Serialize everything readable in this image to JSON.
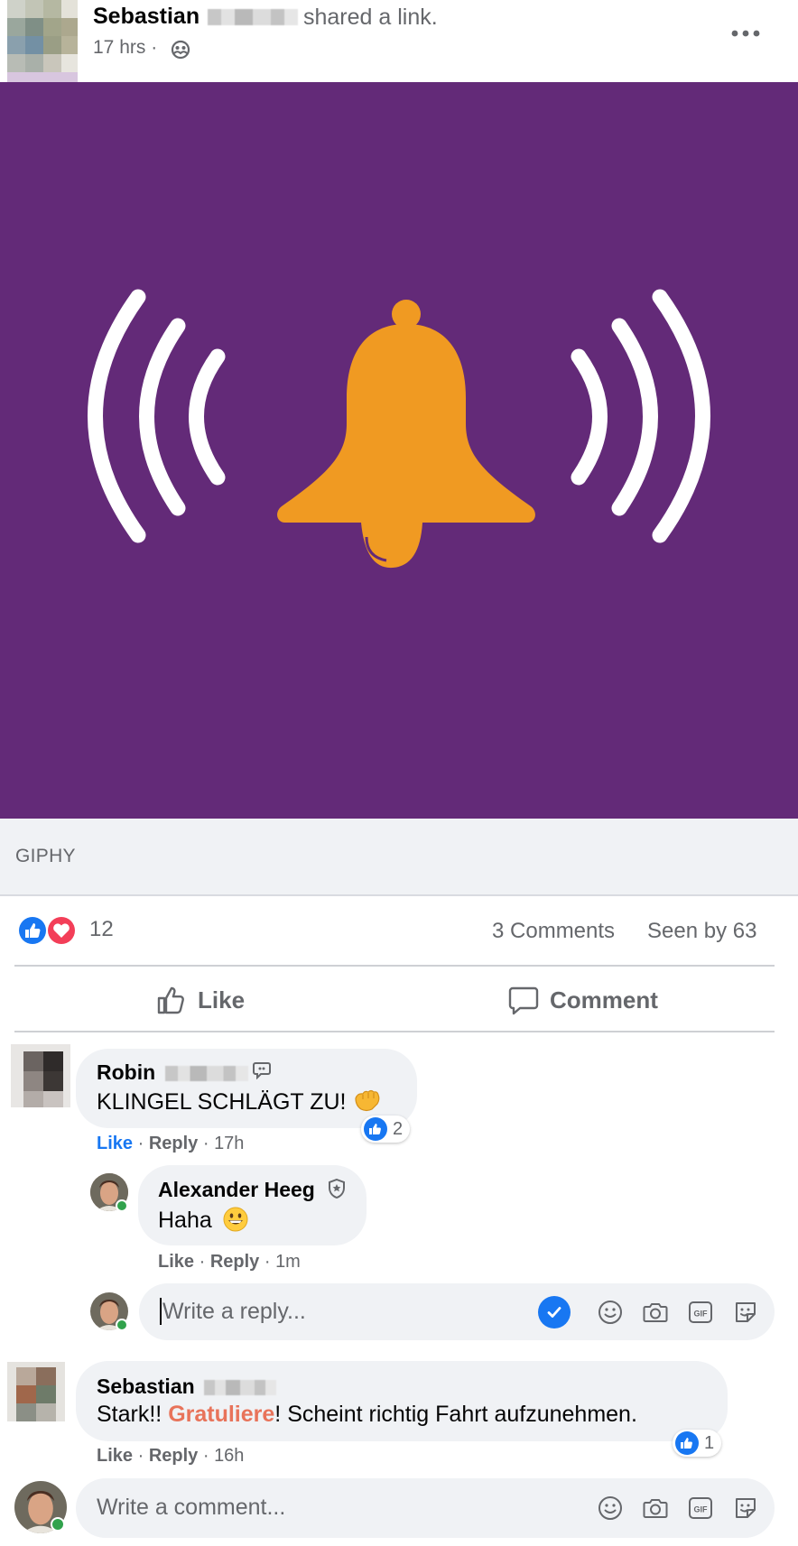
{
  "post": {
    "author_first": "Sebastian",
    "shared_text": "shared a link.",
    "time": "17 hrs ·",
    "gif_source": "GIPHY",
    "reaction_count": "12",
    "comments_count": "3 Comments",
    "seen_by": "Seen by 63"
  },
  "actions": {
    "like_label": "Like",
    "comment_label": "Comment"
  },
  "comments": [
    {
      "name": "Robin",
      "text": "KLINGEL SCHLÄGT ZU!",
      "like_label": "Like",
      "reply_label": "Reply",
      "time": "17h",
      "reaction_count": "2"
    },
    {
      "name": "Alexander Heeg",
      "text": "Haha",
      "like_label": "Like",
      "reply_label": "Reply",
      "time": "1m"
    },
    {
      "name": "Sebastian",
      "text_before": "Stark!! ",
      "text_highlight": "Gratuliere",
      "text_after": "! Scheint richtig Fahrt aufzunehmen.",
      "like_label": "Like",
      "reply_label": "Reply",
      "time": "16h",
      "reaction_count": "1"
    }
  ],
  "reply_box": {
    "placeholder": "Write a reply..."
  },
  "comment_box": {
    "placeholder": "Write a comment..."
  },
  "colors": {
    "gif_background": "#632a78",
    "bell": "#f09a22",
    "facebook_blue": "#1877f2",
    "love_red": "#f33e58",
    "highlight": "#e8735a"
  },
  "icons": {
    "privacy": "friends-icon",
    "more": "more-options-icon",
    "like": "thumbs-up-icon",
    "comment": "speech-bubble-icon",
    "tools": [
      "emoji-icon",
      "camera-icon",
      "gif-icon",
      "sticker-icon"
    ]
  }
}
